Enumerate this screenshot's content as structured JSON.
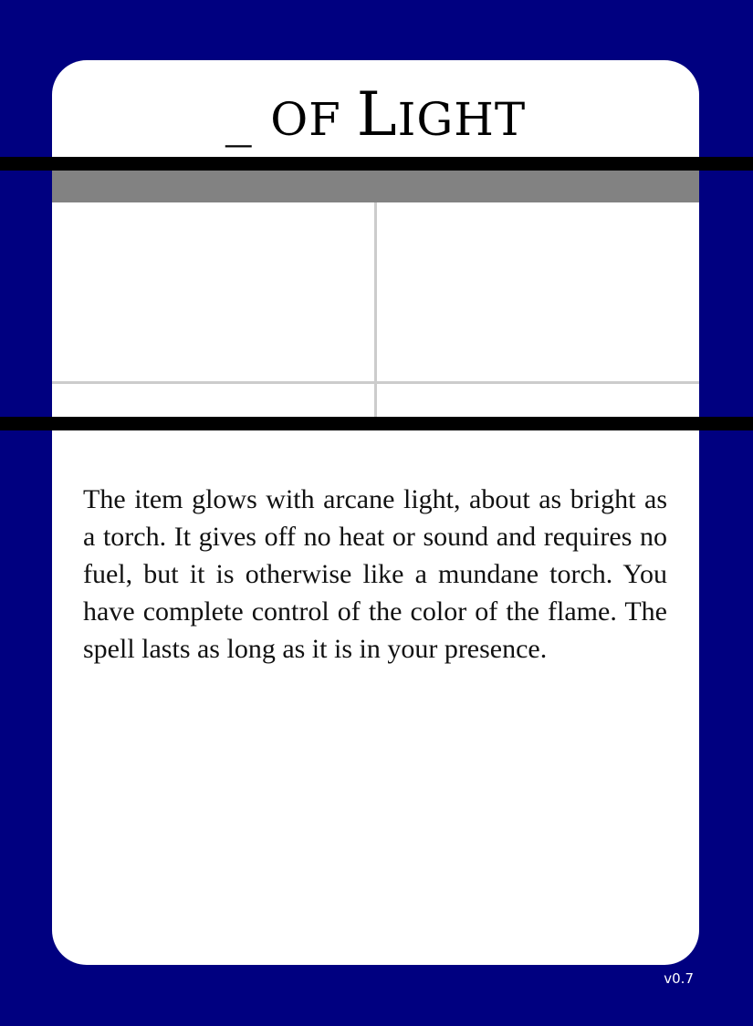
{
  "card": {
    "title_prefix": "_ ",
    "title_word1_big": "",
    "title_word1_rest": "OF ",
    "title_word2_big": "L",
    "title_word2_rest": "IGHT",
    "description": "The item glows with arcane light, about as bright as a torch. It gives off no heat or sound and requires no fuel, but it is otherwise like a mundane torch. You have complete control of the color of the flame. The spell lasts as long as it is in your presence.",
    "version": "v0.7"
  },
  "colors": {
    "background": "#000080",
    "panel": "#ffffff",
    "band": "#828282",
    "bar": "#000000",
    "grid_line": "#cccccc"
  }
}
